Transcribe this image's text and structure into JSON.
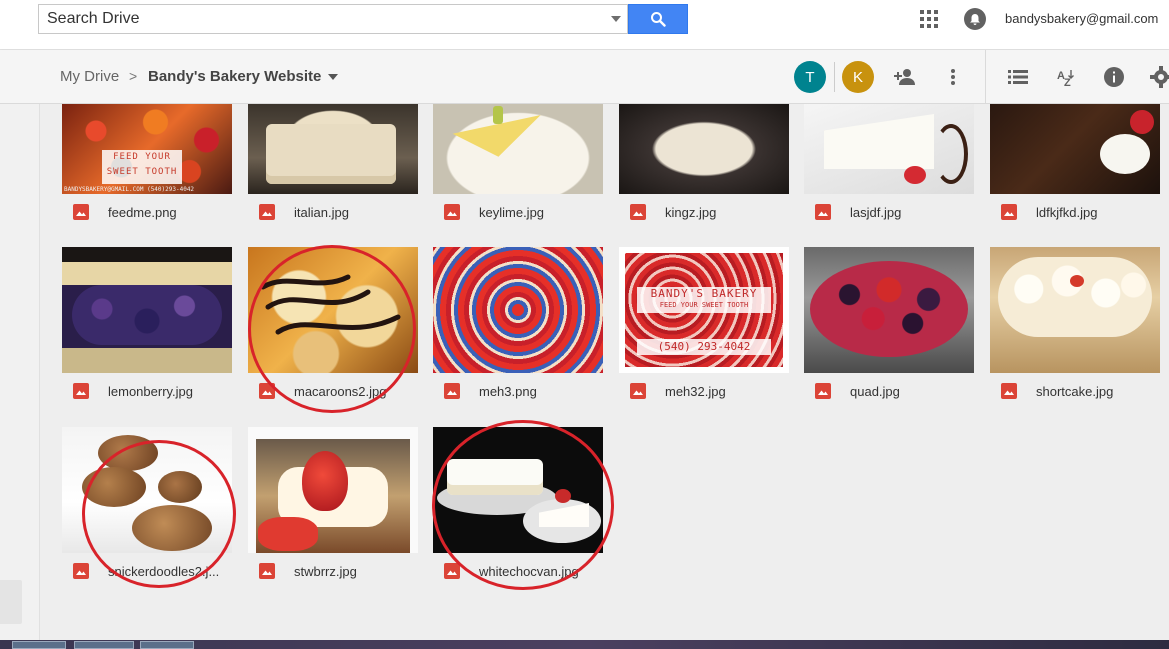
{
  "search": {
    "placeholder": "Search Drive"
  },
  "account": {
    "email": "bandysbakery@gmail.com"
  },
  "breadcrumb": {
    "root": "My Drive",
    "separator": ">",
    "current": "Bandy's Bakery Website"
  },
  "avatars": [
    {
      "letter": "T",
      "color": "#00838f"
    },
    {
      "letter": "K",
      "color": "#c8920e"
    }
  ],
  "toolbar_icons": [
    "add-person-icon",
    "more-vert-icon",
    "list-view-icon",
    "sort-az-icon",
    "info-icon",
    "settings-icon"
  ],
  "colors": {
    "accent": "#4285f4",
    "annotation": "#d8232a",
    "image_icon": "#db4437"
  },
  "files": [
    {
      "name": "feedme.png",
      "thumb": "feedme"
    },
    {
      "name": "italian.jpg",
      "thumb": "italian"
    },
    {
      "name": "keylime.jpg",
      "thumb": "keylime"
    },
    {
      "name": "kingz.jpg",
      "thumb": "kingz"
    },
    {
      "name": "lasjdf.jpg",
      "thumb": "lasjdf"
    },
    {
      "name": "ldfkjfkd.jpg",
      "thumb": "ldfkjfkd"
    },
    {
      "name": "lemonberry.jpg",
      "thumb": "lemonberry"
    },
    {
      "name": "macaroons2.jpg",
      "thumb": "macaroons"
    },
    {
      "name": "meh3.png",
      "thumb": "meh3"
    },
    {
      "name": "meh32.jpg",
      "thumb": "meh32"
    },
    {
      "name": "quad.jpg",
      "thumb": "quad"
    },
    {
      "name": "shortcake.jpg",
      "thumb": "shortcake"
    },
    {
      "name": "snickerdoodles2.j...",
      "thumb": "snickerdoodles"
    },
    {
      "name": "stwbrrz.jpg",
      "thumb": "stwbrrz"
    },
    {
      "name": "whitechocvan.jpg",
      "thumb": "whitechocvan"
    }
  ],
  "thumb_text": {
    "feedme_line1": "FEED YOUR",
    "feedme_line2": "SWEET TOOTH",
    "feedme_footer": "BANDYSBAKERY@GMAIL.COM (540)293-4042",
    "meh32_line1": "BANDY'S BAKERY",
    "meh32_line2": "FEED YOUR SWEET TOOTH",
    "meh32_line3": "(540) 293-4042"
  },
  "annotations": [
    "macaroons2.jpg",
    "snickerdoodles2.j...",
    "whitechocvan.jpg"
  ]
}
